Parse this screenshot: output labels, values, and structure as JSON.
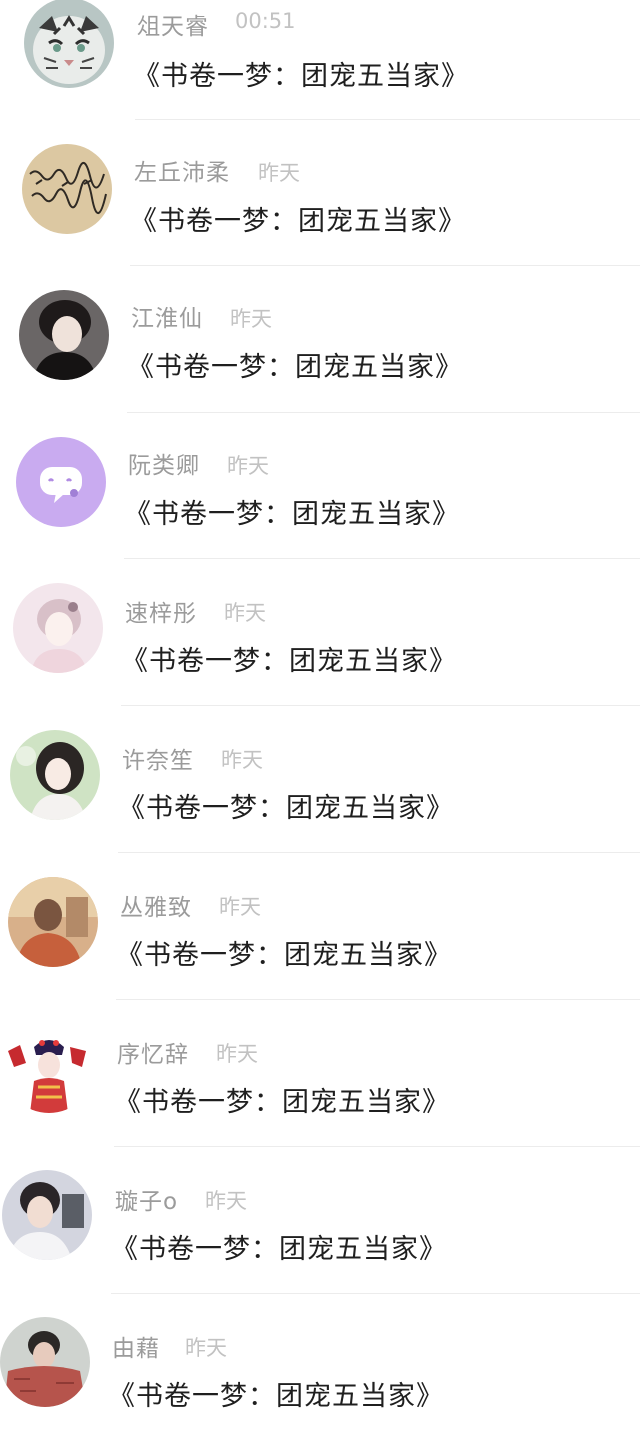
{
  "messages": [
    {
      "name": "俎天睿",
      "time": "00:51",
      "preview": "《书卷一梦：团宠五当家》",
      "avatar_icon": "tiger-avatar",
      "avatar_color": "#8fa6a3"
    },
    {
      "name": "左丘沛柔",
      "time": "昨天",
      "preview": "《书卷一梦：团宠五当家》",
      "avatar_icon": "handwriting-avatar",
      "avatar_color": "#d8c29a"
    },
    {
      "name": "江淮仙",
      "time": "昨天",
      "preview": "《书卷一梦：团宠五当家》",
      "avatar_icon": "portrait-avatar",
      "avatar_color": "#3a3232"
    },
    {
      "name": "阮类卿",
      "time": "昨天",
      "preview": "《书卷一梦：团宠五当家》",
      "avatar_icon": "chat-bubble-avatar",
      "avatar_color": "#c6a9ee"
    },
    {
      "name": "速梓彤",
      "time": "昨天",
      "preview": "《书卷一梦：团宠五当家》",
      "avatar_icon": "portrait-avatar",
      "avatar_color": "#f1e1e7"
    },
    {
      "name": "许奈笙",
      "time": "昨天",
      "preview": "《书卷一梦：团宠五当家》",
      "avatar_icon": "portrait-avatar",
      "avatar_color": "#d4e6c8"
    },
    {
      "name": "丛雅致",
      "time": "昨天",
      "preview": "《书卷一梦：团宠五当家》",
      "avatar_icon": "portrait-avatar",
      "avatar_color": "#c98a5e"
    },
    {
      "name": "序忆辞",
      "time": "昨天",
      "preview": "《书卷一梦：团宠五当家》",
      "avatar_icon": "opera-avatar",
      "avatar_color": "#c4282d"
    },
    {
      "name": "璇子o",
      "time": "昨天",
      "preview": "《书卷一梦：团宠五当家》",
      "avatar_icon": "portrait-avatar",
      "avatar_color": "#d8d9e2"
    },
    {
      "name": "由藉",
      "time": "昨天",
      "preview": "《书卷一梦：团宠五当家》",
      "avatar_icon": "portrait-avatar",
      "avatar_color": "#b85e55"
    }
  ]
}
